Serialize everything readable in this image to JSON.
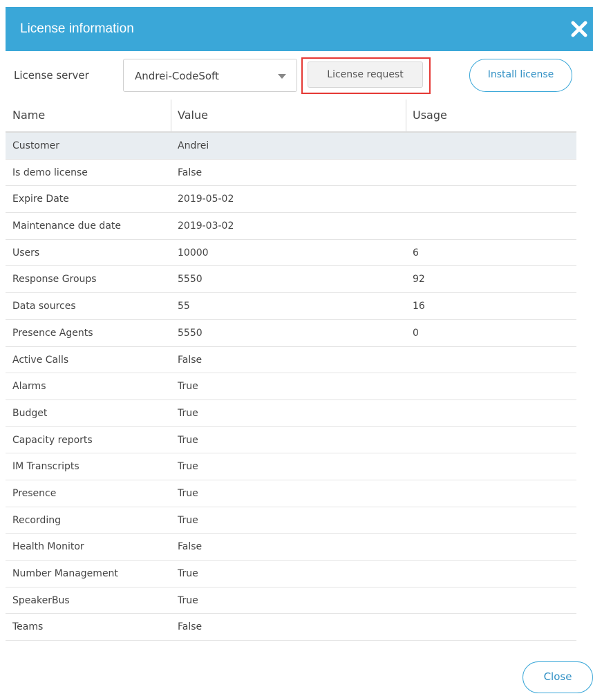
{
  "dialog": {
    "title": "License information",
    "close_icon": "close-icon"
  },
  "toolbar": {
    "server_label": "License server",
    "server_value": "Andrei-CodeSoft",
    "request_label": "License request",
    "install_label": "Install license"
  },
  "table": {
    "headers": [
      "Name",
      "Value",
      "Usage"
    ],
    "rows": [
      {
        "name": "Customer",
        "value": "Andrei",
        "usage": ""
      },
      {
        "name": "Is demo license",
        "value": "False",
        "usage": ""
      },
      {
        "name": "Expire Date",
        "value": "2019-05-02",
        "usage": ""
      },
      {
        "name": "Maintenance due date",
        "value": "2019-03-02",
        "usage": ""
      },
      {
        "name": "Users",
        "value": "10000",
        "usage": "6"
      },
      {
        "name": "Response Groups",
        "value": "5550",
        "usage": "92"
      },
      {
        "name": "Data sources",
        "value": "55",
        "usage": "16"
      },
      {
        "name": "Presence Agents",
        "value": "5550",
        "usage": "0"
      },
      {
        "name": "Active Calls",
        "value": "False",
        "usage": ""
      },
      {
        "name": "Alarms",
        "value": "True",
        "usage": ""
      },
      {
        "name": "Budget",
        "value": "True",
        "usage": ""
      },
      {
        "name": "Capacity reports",
        "value": "True",
        "usage": ""
      },
      {
        "name": "IM Transcripts",
        "value": "True",
        "usage": ""
      },
      {
        "name": "Presence",
        "value": "True",
        "usage": ""
      },
      {
        "name": "Recording",
        "value": "True",
        "usage": ""
      },
      {
        "name": "Health Monitor",
        "value": "False",
        "usage": ""
      },
      {
        "name": "Number Management",
        "value": "True",
        "usage": ""
      },
      {
        "name": "SpeakerBus",
        "value": "True",
        "usage": ""
      },
      {
        "name": "Teams",
        "value": "False",
        "usage": ""
      }
    ]
  },
  "footer": {
    "close_label": "Close"
  },
  "colors": {
    "header": "#3aa7d8",
    "highlight": "#e53935",
    "selected_row": "#e8edf1"
  }
}
